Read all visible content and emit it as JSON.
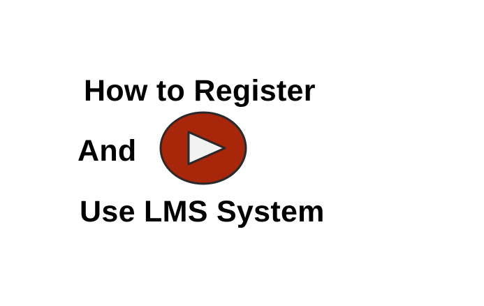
{
  "heading": {
    "line1": "How to Register",
    "line2": "And",
    "line3": "Use LMS System"
  },
  "play_button": {
    "icon": "play-icon",
    "fill_color": "#a8260a",
    "outline_color": "#2a2a2a",
    "triangle_color": "#f2f2f2"
  }
}
